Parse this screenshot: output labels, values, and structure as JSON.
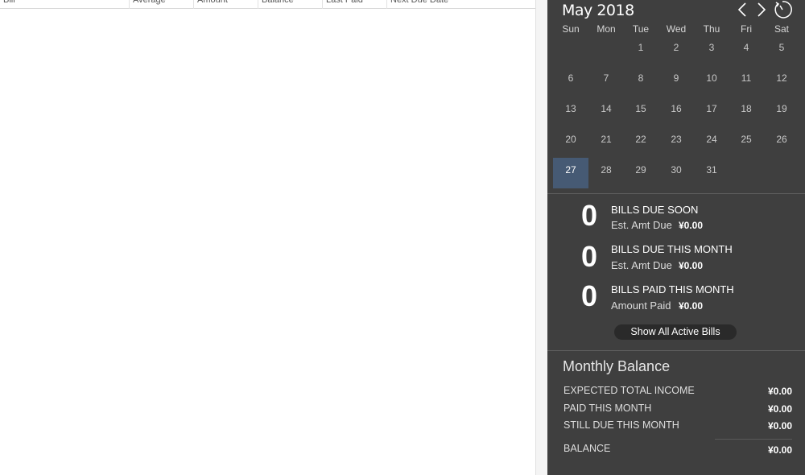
{
  "table": {
    "columns": [
      "Bill",
      "Average",
      "Amount",
      "Balance",
      "Last Paid",
      "Next Due Date"
    ]
  },
  "calendar": {
    "month_title": "May 2018",
    "weekdays": [
      "Sun",
      "Mon",
      "Tue",
      "Wed",
      "Thu",
      "Fri",
      "Sat"
    ],
    "days": [
      "1",
      "2",
      "3",
      "4",
      "5",
      "6",
      "7",
      "8",
      "9",
      "10",
      "11",
      "12",
      "13",
      "14",
      "15",
      "16",
      "17",
      "18",
      "19",
      "20",
      "21",
      "22",
      "23",
      "24",
      "25",
      "26",
      "27",
      "28",
      "29",
      "30",
      "31"
    ],
    "today": "27"
  },
  "summary": {
    "due_soon": {
      "count": "0",
      "title": "BILLS DUE SOON",
      "label": "Est. Amt Due",
      "value": "¥0.00"
    },
    "due_month": {
      "count": "0",
      "title": "BILLS DUE THIS MONTH",
      "label": "Est. Amt Due",
      "value": "¥0.00"
    },
    "paid_month": {
      "count": "0",
      "title": "BILLS PAID THIS MONTH",
      "label": "Amount Paid",
      "value": "¥0.00"
    },
    "show_all_label": "Show All Active Bills"
  },
  "monthly_balance": {
    "title": "Monthly Balance",
    "expected_income_label": "EXPECTED TOTAL INCOME",
    "expected_income_value": "¥0.00",
    "paid_label": "PAID THIS MONTH",
    "paid_value": "¥0.00",
    "still_due_label": "STILL DUE THIS MONTH",
    "still_due_value": "¥0.00",
    "balance_label": "BALANCE",
    "balance_value": "¥0.00"
  },
  "icons": {
    "prev": "chevron-left-icon",
    "next": "chevron-right-icon",
    "today": "clock-refresh-icon"
  },
  "colors": {
    "panel_bg": "#3f3f3f",
    "today_highlight": "#465a74"
  }
}
